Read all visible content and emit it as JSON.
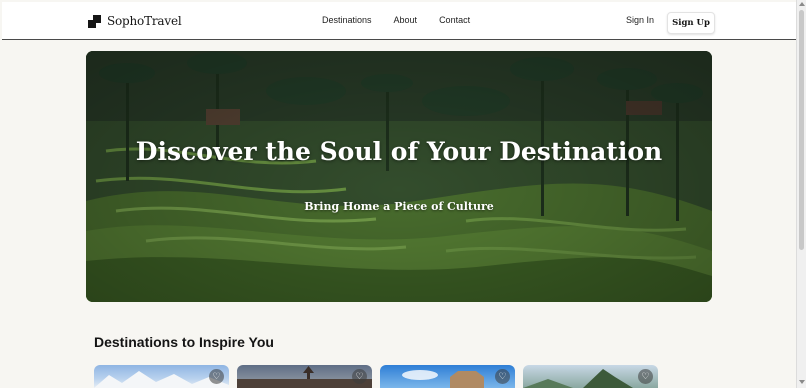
{
  "brand": {
    "name": "SophoTravel"
  },
  "nav": {
    "links": [
      "Destinations",
      "About",
      "Contact"
    ],
    "sign_in": "Sign In",
    "sign_up": "Sign Up"
  },
  "hero": {
    "title": "Discover the Soul of Your Destination",
    "subtitle": "Bring Home a Piece of Culture"
  },
  "destinations": {
    "heading": "Destinations to Inspire You",
    "cards": [
      {
        "icon": "heart-icon"
      },
      {
        "icon": "heart-icon"
      },
      {
        "icon": "heart-icon"
      },
      {
        "icon": "heart-icon"
      }
    ]
  },
  "colors": {
    "page_bg": "#f7f6f2",
    "nav_bg": "#ffffff",
    "text": "#151515",
    "hero_green": "#3e5f26"
  }
}
